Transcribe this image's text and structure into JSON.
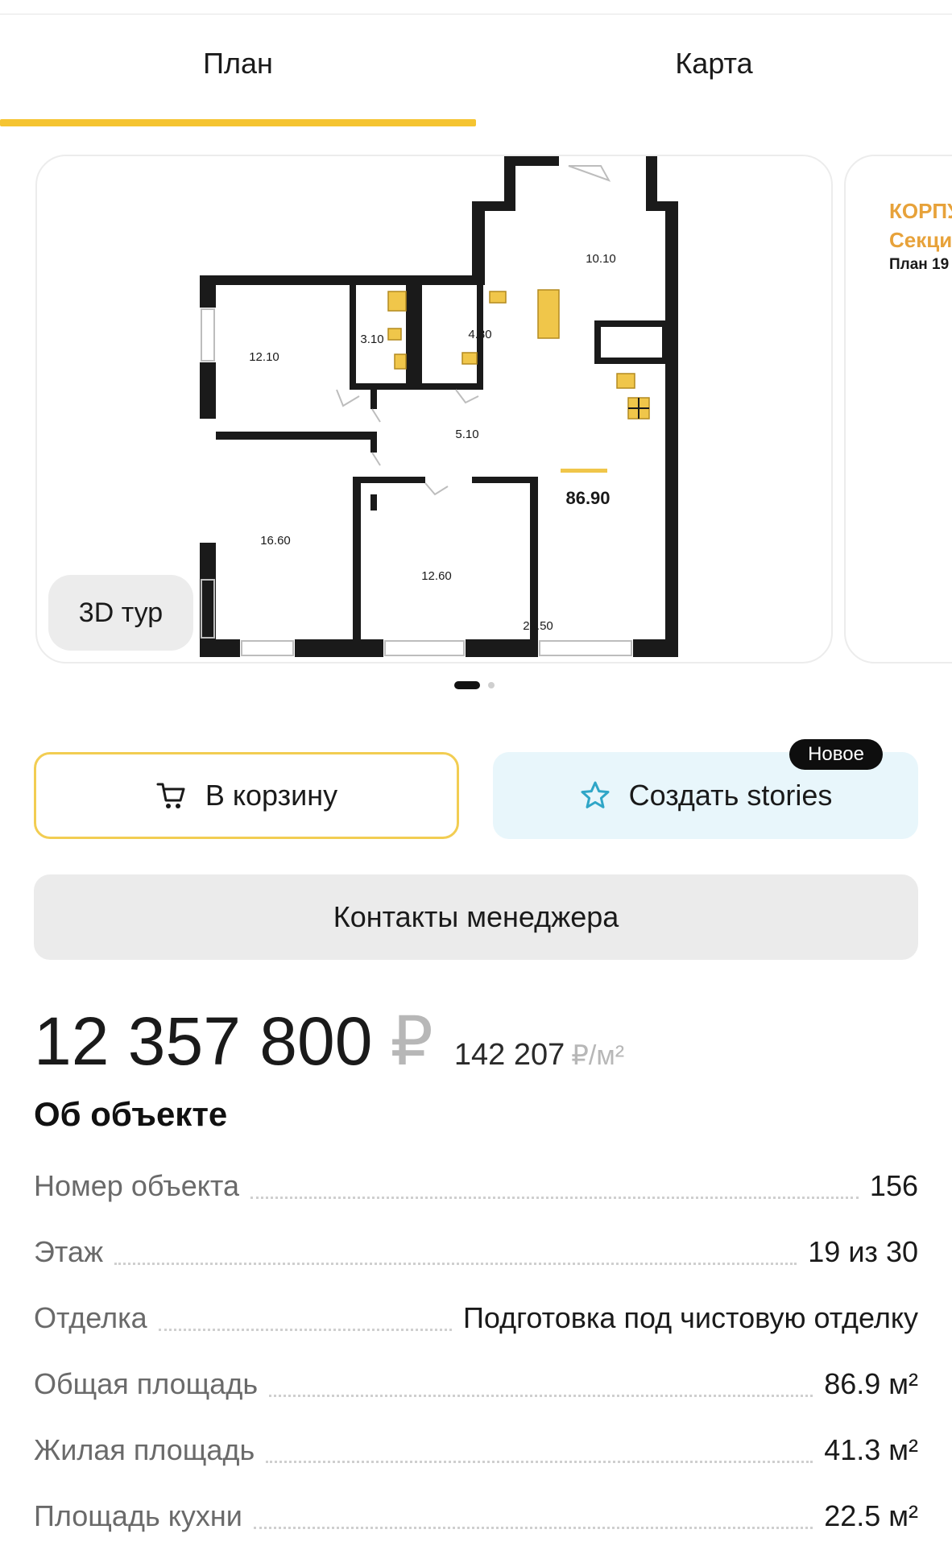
{
  "tabs": [
    {
      "label": "План",
      "active": true
    },
    {
      "label": "Карта",
      "active": false
    }
  ],
  "colors": {
    "accent": "#f5c431",
    "stories_bg": "#e8f6fb",
    "star": "#2fa6c7",
    "next_card_text": "#e7a23a"
  },
  "gallery": {
    "tour_label": "3D тур",
    "slide_count": 2,
    "active_slide": 1,
    "floorplan": {
      "rooms": [
        "12.10",
        "3.10",
        "4.80",
        "10.10",
        "5.10",
        "16.60",
        "12.60",
        "22.50"
      ],
      "total_area": "86.90"
    },
    "next_card": {
      "line1": "КОРПУ",
      "line2": "Секци",
      "line3": "План 19"
    }
  },
  "actions": {
    "cart_label": "В корзину",
    "cart_icon": "cart-icon",
    "stories_label": "Создать stories",
    "stories_icon": "star-icon",
    "new_badge": "Новое",
    "contacts_label": "Контакты менеджера"
  },
  "price": {
    "amount": "12 357 800",
    "currency": "₽",
    "per_m2": "142 207",
    "per_m2_unit": "₽/м²"
  },
  "about": {
    "title": "Об объекте",
    "rows": [
      {
        "label": "Номер объекта",
        "value": "156"
      },
      {
        "label": "Этаж",
        "value": "19 из 30"
      },
      {
        "label": "Отделка",
        "value": "Подготовка под чистовую отделку"
      },
      {
        "label": "Общая площадь",
        "value": "86.9 м²"
      },
      {
        "label": "Жилая площадь",
        "value": "41.3 м²"
      },
      {
        "label": "Площадь кухни",
        "value": "22.5 м²"
      }
    ]
  }
}
